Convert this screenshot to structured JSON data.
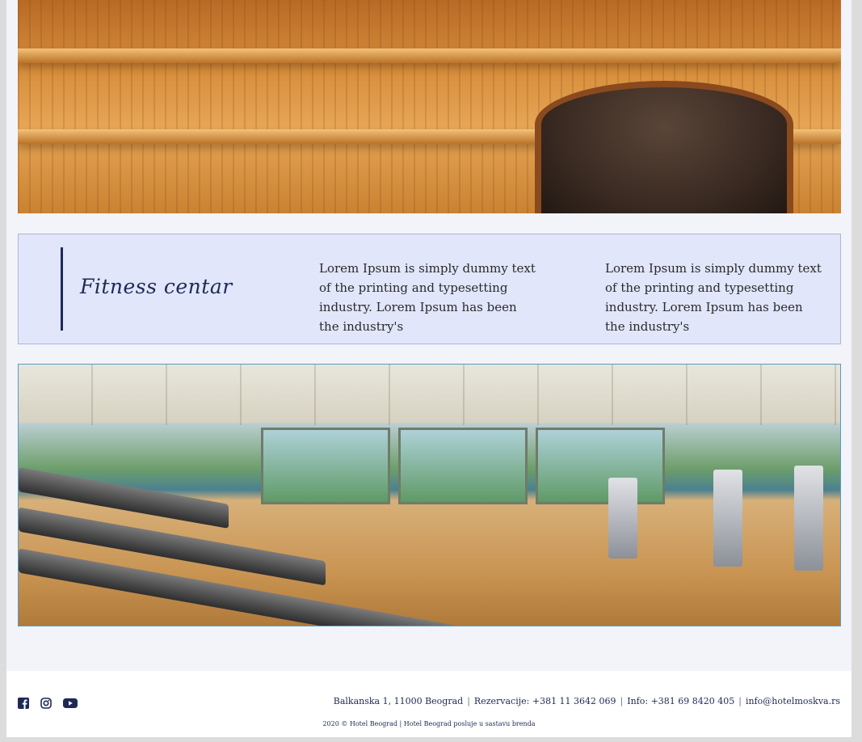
{
  "fitness": {
    "title": "Fitness centar",
    "text1": "Lorem Ipsum is simply dummy text of the printing and typesetting industry. Lorem Ipsum has been the industry's",
    "text2": "Lorem Ipsum is simply dummy text of the printing and typesetting industry. Lorem Ipsum has been the industry's"
  },
  "footer": {
    "social_icons": [
      "facebook-icon",
      "instagram-icon",
      "youtube-icon"
    ],
    "address": "Balkanska 1, 11000 Beograd",
    "reservations": "Rezervacije: +381 11 3642 069",
    "info_phone": "Info: +381 69 8420 405",
    "email": "info@hotelmoskva.rs",
    "separator": "|",
    "copyright": "2020 © Hotel Beograd | Hotel Beograd posluje u sastavu brenda"
  },
  "colors": {
    "accent": "#1d2a55",
    "band_bg": "#e1e6fa",
    "page_bg": "#f2f4fa"
  }
}
